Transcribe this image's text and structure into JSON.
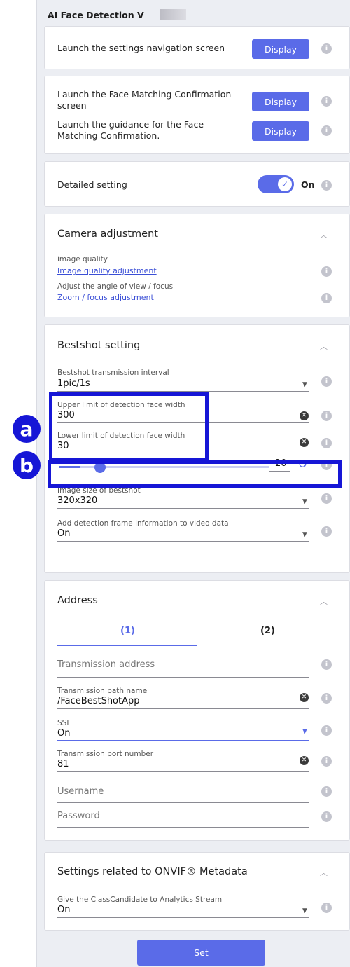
{
  "app": {
    "title": "AI Face Detection V"
  },
  "launch": {
    "settings_nav_label": "Launch the settings navigation screen",
    "face_matching_label": "Launch the Face Matching Confirmation screen",
    "guidance_label": "Launch the guidance for the Face Matching Confirmation.",
    "display_label": "Display"
  },
  "detailed": {
    "label": "Detailed setting",
    "state": "On"
  },
  "camera": {
    "title": "Camera adjustment",
    "quality_label": "image quality",
    "quality_link": "Image quality adjustment",
    "angle_label": "Adjust the angle of view / focus",
    "zoom_link": "Zoom / focus adjustment"
  },
  "bestshot": {
    "title": "Bestshot setting",
    "interval_label": "Bestshot transmission interval",
    "interval_value": "1pic/1s",
    "upper_label": "Upper limit of detection face width",
    "upper_value": "300",
    "lower_label": "Lower limit of detection face width",
    "lower_value": "30",
    "slider_value": "20",
    "slider_fraction": 0.1,
    "size_label": "Image size of bestshot",
    "size_value": "320x320",
    "frame_label": "Add detection frame information to video data",
    "frame_value": "On"
  },
  "address": {
    "title": "Address",
    "tabs": [
      "(1)",
      "(2)"
    ],
    "transmission_address_placeholder": "Transmission address",
    "path_label": "Transmission path name",
    "path_value": "/FaceBestShotApp",
    "ssl_label": "SSL",
    "ssl_value": "On",
    "port_label": "Transmission port number",
    "port_value": "81",
    "username_placeholder": "Username",
    "password_placeholder": "Password"
  },
  "onvif": {
    "title": "Settings related to ONVIF® Metadata",
    "class_label": "Give the ClassCandidate to Analytics Stream",
    "class_value": "On"
  },
  "annotations": {
    "a": "a",
    "b": "b"
  },
  "footer": {
    "set_label": "Set"
  },
  "colors": {
    "accent": "#5a6be8",
    "highlight": "#1616d6"
  },
  "icons": {
    "info": "info-icon",
    "chevron_up": "chevron-up-icon",
    "dropdown": "dropdown-arrow-icon",
    "clear": "clear-icon",
    "reset": "reset-icon",
    "check": "check-icon"
  }
}
